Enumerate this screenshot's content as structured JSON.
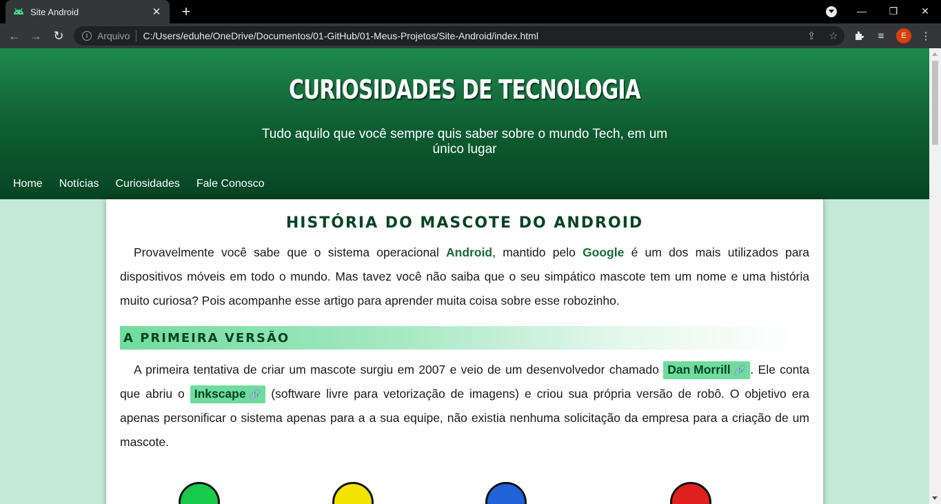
{
  "browser": {
    "tab_title": "Site Android",
    "tab_close": "✕",
    "new_tab": "+",
    "url_scheme": "Arquivo",
    "url": "C:/Users/eduhe/OneDrive/Documentos/01-GitHub/01-Meus-Projetos/Site-Android/index.html",
    "profile_initial": "E",
    "window_controls": {
      "minimize": "—",
      "restore": "❐",
      "close": "✕"
    }
  },
  "header": {
    "title": "CURIOSIDADES DE TECNOLOGIA",
    "subtitle": "Tudo aquilo que você sempre quis saber sobre o mundo Tech, em um único lugar"
  },
  "nav": {
    "items": [
      {
        "label": "Home"
      },
      {
        "label": "Notícias"
      },
      {
        "label": "Curiosidades"
      },
      {
        "label": "Fale Conosco"
      }
    ]
  },
  "article": {
    "title": "HISTÓRIA DO MASCOTE DO ANDROID",
    "intro": {
      "part1": "Provavelmente você sabe que o sistema operacional ",
      "highlight1": "Android",
      "part2": ", mantido pelo ",
      "highlight2": "Google",
      "part3": " é um dos mais utilizados para dispositivos móveis em todo o mundo. Mas tavez você não saiba que o seu simpático mascote tem um nome e uma história muito curiosa? Pois acompanhe esse artigo para aprender muita coisa sobre esse robozinho."
    },
    "section1": {
      "heading": "A PRIMEIRA VERSÃO",
      "part1": "A primeira tentativa de criar um mascote surgiu em 2007 e veio de um desenvolvedor chamado ",
      "link1": "Dan Morrill",
      "part2": ". Ele conta que abriu o ",
      "link2": "Inkscape",
      "part3": " (software livre para vetorização de imagens) e criou sua própria versão de robô. O objetivo era apenas personificar o sistema apenas para a a sua equipe, não existia nenhuma solicitação da empresa para a criação de um mascote."
    }
  },
  "colors": {
    "header_top": "#1f8a4d",
    "header_bottom": "#064423",
    "page_bg": "#c4ead6",
    "highlight": "#6fdc9d",
    "mascots": [
      "#18c94a",
      "#f2e300",
      "#2162d8",
      "#e0201c"
    ]
  },
  "icons": {
    "link": "link-icon",
    "android": "android-icon"
  }
}
